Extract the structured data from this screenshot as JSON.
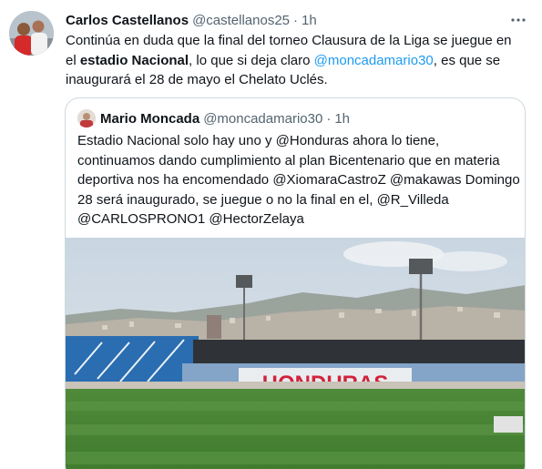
{
  "tweet": {
    "author_name": "Carlos Castellanos",
    "author_handle": "@castellanos25",
    "separator": "·",
    "time": "1h",
    "text_1": "Continúa en duda que la final del torneo Clausura de la Liga se juegue en el ",
    "text_bold": "estadio Nacional",
    "text_2": ", lo que si deja claro ",
    "text_mention": "@moncadamario30",
    "text_3": ", es que se inaugurará el 28 de mayo el Chelato Uclés.",
    "more_icon": "more-horizontal-icon"
  },
  "quote": {
    "author_name": "Mario Moncada",
    "author_handle": "@moncadamario30",
    "separator": "·",
    "time": "1h",
    "text": "Estadio Nacional solo hay uno y @Honduras ahora lo tiene, continuamos dando cumplimiento al plan Bicentenario que en materia deportiva nos ha encomendado @XiomaraCastroZ @makawas Domingo 28 será inaugurado, se juegue o no la final en el, @R_Villeda @CARLOSPRONO1 @HectorZelaya",
    "photo_lettering": "HONDURAS"
  },
  "colors": {
    "text": "#0f1419",
    "muted": "#536471",
    "link": "#1d9bf0",
    "border": "#cfd9de",
    "lettering": "#d2233a"
  }
}
